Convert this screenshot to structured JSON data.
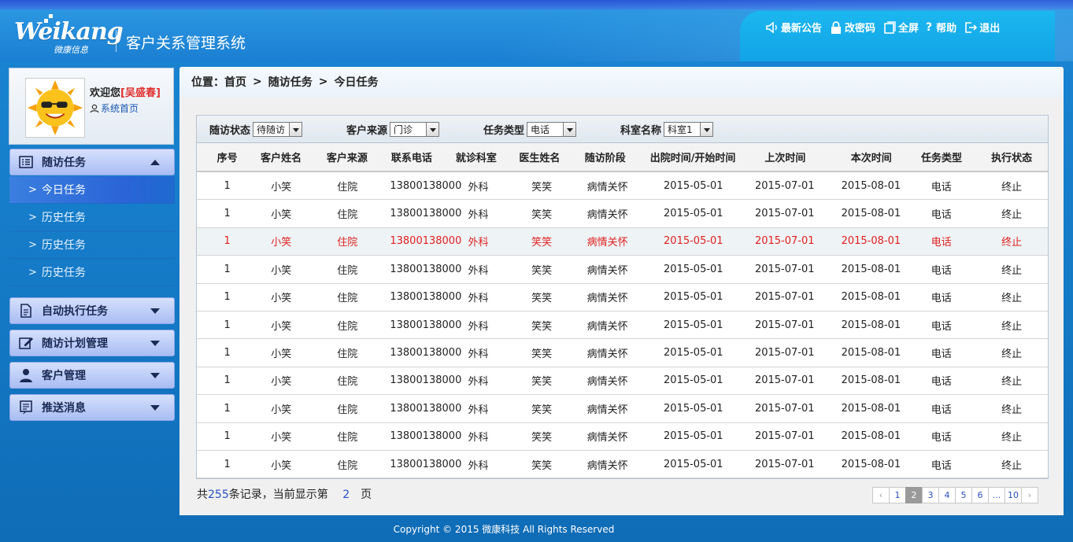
{
  "header": {
    "brand": "Weikang",
    "brand_sub": "微康信息",
    "system_name": "客户关系管理系统",
    "nav": [
      {
        "icon": "speaker-icon",
        "label": "最新公告"
      },
      {
        "icon": "lock-icon",
        "label": "改密码"
      },
      {
        "icon": "fullscreen-icon",
        "label": "全屏"
      },
      {
        "icon": "help-icon",
        "label": "帮助"
      },
      {
        "icon": "logout-icon",
        "label": "退出"
      }
    ]
  },
  "sidebar": {
    "welcome": "欢迎您",
    "username": "[吴盛春]",
    "home_link": "系统首页",
    "menu": [
      {
        "icon": "list-icon",
        "label": "随访任务",
        "expanded": true,
        "items": [
          "今日任务",
          "历史任务",
          "历史任务",
          "历史任务"
        ]
      },
      {
        "icon": "document-icon",
        "label": "自动执行任务"
      },
      {
        "icon": "edit-icon",
        "label": "随访计划管理"
      },
      {
        "icon": "user-icon",
        "label": "客户管理"
      },
      {
        "icon": "message-icon",
        "label": "推送消息"
      }
    ]
  },
  "breadcrumb": {
    "prefix": "位置：",
    "items": [
      "首页",
      "随访任务",
      "今日任务"
    ]
  },
  "filters": [
    {
      "label": "随访状态",
      "value": "待随访"
    },
    {
      "label": "客户来源",
      "value": "门诊"
    },
    {
      "label": "任务类型",
      "value": "电话"
    },
    {
      "label": "科室名称",
      "value": "科室1"
    }
  ],
  "table": {
    "columns": [
      "序号",
      "客户姓名",
      "客户来源",
      "联系电话",
      "就诊科室",
      "医生姓名",
      "随访阶段",
      "出院时间/开始时间",
      "上次时间",
      "本次时间",
      "任务类型",
      "执行状态"
    ],
    "rows": [
      [
        "1",
        "小笑",
        "住院",
        "13800138000",
        "外科",
        "笑笑",
        "病情关怀",
        "2015-05-01",
        "2015-07-01",
        "2015-08-01",
        "电话",
        "终止"
      ],
      [
        "1",
        "小笑",
        "住院",
        "13800138000",
        "外科",
        "笑笑",
        "病情关怀",
        "2015-05-01",
        "2015-07-01",
        "2015-08-01",
        "电话",
        "终止"
      ],
      [
        "1",
        "小笑",
        "住院",
        "13800138000",
        "外科",
        "笑笑",
        "病情关怀",
        "2015-05-01",
        "2015-07-01",
        "2015-08-01",
        "电话",
        "终止"
      ],
      [
        "1",
        "小笑",
        "住院",
        "13800138000",
        "外科",
        "笑笑",
        "病情关怀",
        "2015-05-01",
        "2015-07-01",
        "2015-08-01",
        "电话",
        "终止"
      ],
      [
        "1",
        "小笑",
        "住院",
        "13800138000",
        "外科",
        "笑笑",
        "病情关怀",
        "2015-05-01",
        "2015-07-01",
        "2015-08-01",
        "电话",
        "终止"
      ],
      [
        "1",
        "小笑",
        "住院",
        "13800138000",
        "外科",
        "笑笑",
        "病情关怀",
        "2015-05-01",
        "2015-07-01",
        "2015-08-01",
        "电话",
        "终止"
      ],
      [
        "1",
        "小笑",
        "住院",
        "13800138000",
        "外科",
        "笑笑",
        "病情关怀",
        "2015-05-01",
        "2015-07-01",
        "2015-08-01",
        "电话",
        "终止"
      ],
      [
        "1",
        "小笑",
        "住院",
        "13800138000",
        "外科",
        "笑笑",
        "病情关怀",
        "2015-05-01",
        "2015-07-01",
        "2015-08-01",
        "电话",
        "终止"
      ],
      [
        "1",
        "小笑",
        "住院",
        "13800138000",
        "外科",
        "笑笑",
        "病情关怀",
        "2015-05-01",
        "2015-07-01",
        "2015-08-01",
        "电话",
        "终止"
      ],
      [
        "1",
        "小笑",
        "住院",
        "13800138000",
        "外科",
        "笑笑",
        "病情关怀",
        "2015-05-01",
        "2015-07-01",
        "2015-08-01",
        "电话",
        "终止"
      ],
      [
        "1",
        "小笑",
        "住院",
        "13800138000",
        "外科",
        "笑笑",
        "病情关怀",
        "2015-05-01",
        "2015-07-01",
        "2015-08-01",
        "电话",
        "终止"
      ]
    ],
    "highlight_row": 2,
    "highlight_color": "#e02020"
  },
  "pagination": {
    "total_prefix": "共",
    "total": "255",
    "total_suffix": "条记录，当前显示第",
    "current": "2",
    "page_suffix": "页",
    "pages": [
      "‹",
      "1",
      "2",
      "3",
      "4",
      "5",
      "6",
      "...",
      "10",
      "›"
    ]
  },
  "copyright": "Copyright © 2015 微康科技 All Rights Reserved"
}
